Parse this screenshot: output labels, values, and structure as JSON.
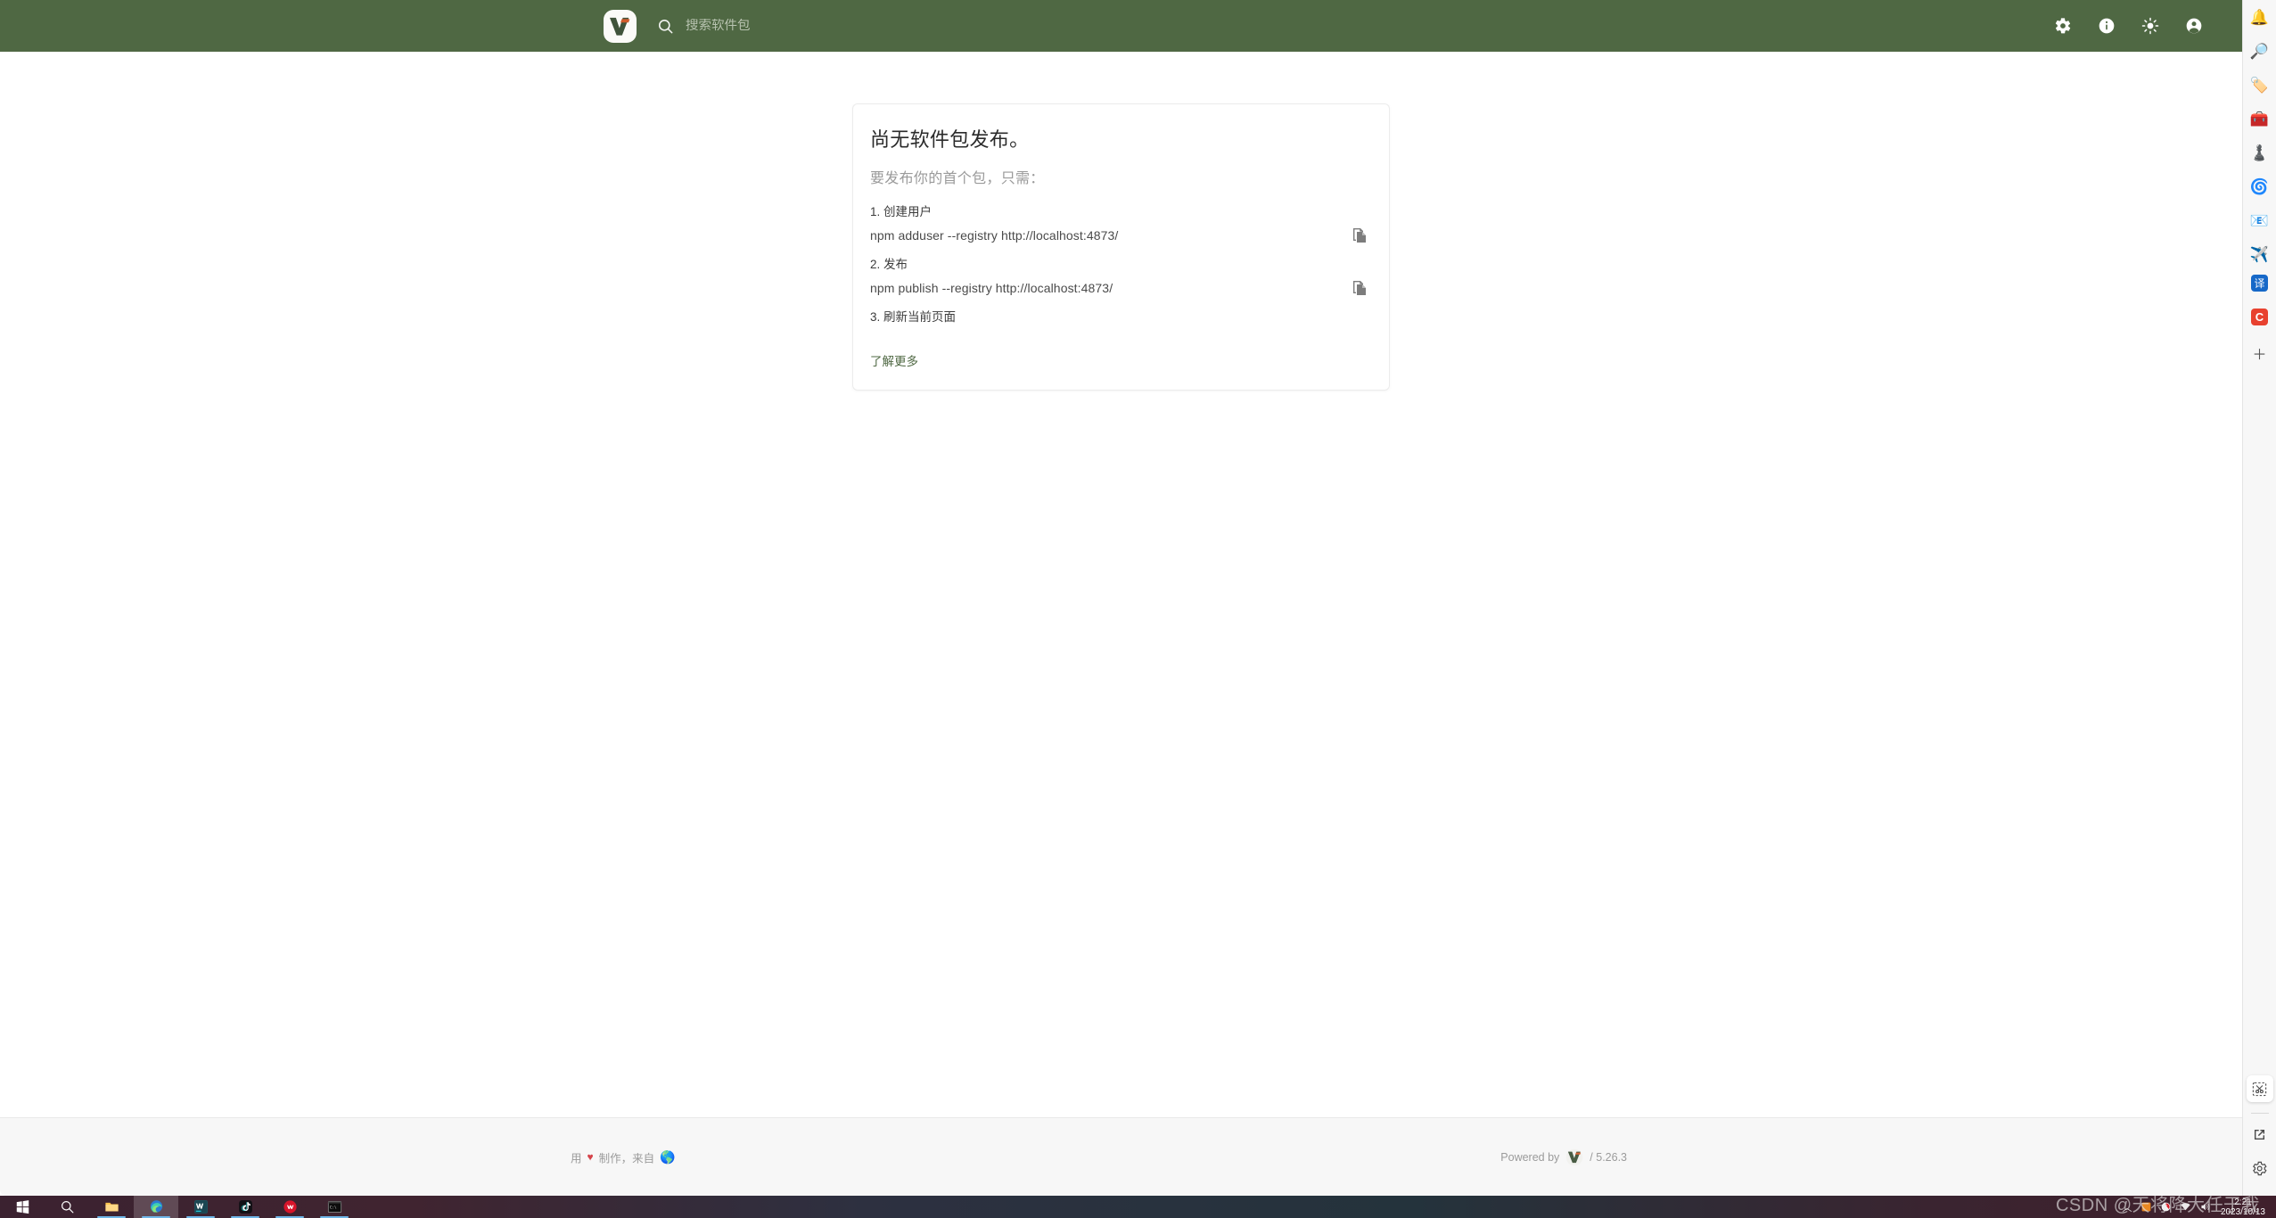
{
  "header": {
    "logo_alt": "verdaccio-logo",
    "search_placeholder": "搜索软件包",
    "search_value": "",
    "actions": [
      {
        "name": "settings",
        "icon": "gear-icon",
        "label": "设置"
      },
      {
        "name": "information",
        "icon": "info-icon",
        "label": "信息"
      },
      {
        "name": "theme-toggle",
        "icon": "sun-icon",
        "label": "主题"
      },
      {
        "name": "account",
        "icon": "account-circle-icon",
        "label": "账户"
      }
    ],
    "background_color": "#4f6843"
  },
  "card": {
    "title": "尚无软件包发布。",
    "subtitle": "要发布你的首个包，只需：",
    "steps": [
      {
        "label": "1. 创建用户",
        "command": "npm adduser --registry http://localhost:4873/",
        "copy_icon": "copy-icon"
      },
      {
        "label": "2. 发布",
        "command": "npm publish --registry http://localhost:4873/",
        "copy_icon": "copy-icon"
      },
      {
        "label": "3. 刷新当前页面",
        "command": "",
        "copy_icon": ""
      }
    ],
    "learn_more": "了解更多",
    "link_color": "#4f6843"
  },
  "footer": {
    "made_prefix": "用",
    "heart": "♥",
    "made_middle": "制作，来自",
    "globe": "🌎",
    "powered_by": "Powered by",
    "version": "/ 5.26.3"
  },
  "edge_sidebar": {
    "top_items": [
      {
        "name": "notifications-icon",
        "glyph": "🔔"
      },
      {
        "name": "bing-search-icon",
        "glyph": "🔎"
      },
      {
        "name": "shopping-tag-icon",
        "glyph": "🏷️"
      },
      {
        "name": "tools-briefcase-icon",
        "glyph": "🧰"
      },
      {
        "name": "games-chess-icon",
        "glyph": "♟️"
      },
      {
        "name": "copilot-icon",
        "glyph": "🌀"
      },
      {
        "name": "outlook-icon",
        "glyph": "📧"
      },
      {
        "name": "telegram-icon",
        "glyph": "✈️"
      },
      {
        "name": "translate-icon",
        "glyph": "译"
      },
      {
        "name": "csdn-icon",
        "glyph": "C"
      },
      {
        "name": "add-sidebar-app-icon",
        "glyph": "＋"
      }
    ],
    "bottom_items": [
      {
        "name": "screenshot-icon",
        "glyph": "scissors"
      },
      {
        "name": "open-in-new-window-icon",
        "glyph": "external"
      },
      {
        "name": "sidebar-settings-icon",
        "glyph": "gear"
      }
    ]
  },
  "taskbar": {
    "items": [
      {
        "name": "start-button",
        "glyph": "windows"
      },
      {
        "name": "taskbar-search",
        "glyph": "search"
      },
      {
        "name": "file-explorer",
        "glyph": "folder"
      },
      {
        "name": "microsoft-edge",
        "glyph": "edge"
      },
      {
        "name": "webstorm",
        "glyph": "ws"
      },
      {
        "name": "tiktok",
        "glyph": "tiktok"
      },
      {
        "name": "maxthon",
        "glyph": "red-circle"
      },
      {
        "name": "terminal",
        "glyph": "terminal"
      }
    ],
    "tray": [
      {
        "name": "tray-chevron-up",
        "glyph": "^"
      },
      {
        "name": "tray-app-orange",
        "glyph": "■"
      },
      {
        "name": "tray-app-white",
        "glyph": "●"
      },
      {
        "name": "tray-network",
        "glyph": "net"
      },
      {
        "name": "tray-volume",
        "glyph": "vol"
      }
    ],
    "clock_time": "2:21",
    "clock_date": "2023/10/13"
  },
  "watermark": {
    "text": "CSDN @天将降大任于我"
  }
}
